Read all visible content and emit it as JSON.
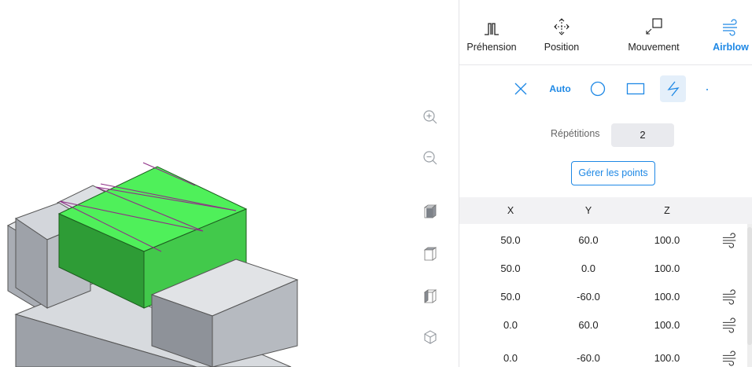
{
  "tabs": [
    {
      "label": "Préhension",
      "icon": "gripper-icon"
    },
    {
      "label": "Position",
      "icon": "move-arrows-icon"
    },
    {
      "label": "Mouvement",
      "icon": "movement-icon"
    },
    {
      "label": "Airblow",
      "icon": "airblow-icon",
      "active": true
    }
  ],
  "shapes": {
    "auto_label": "Auto",
    "selected": "zigzag",
    "accent": "#1e88e5"
  },
  "repetitions": {
    "label": "Répétitions",
    "value": "2"
  },
  "manage_points_label": "Gérer les points",
  "table": {
    "columns": [
      "X",
      "Y",
      "Z"
    ],
    "rows": [
      {
        "x": "50.0",
        "y": "60.0",
        "z": "100.0",
        "airblow": true
      },
      {
        "x": "50.0",
        "y": "0.0",
        "z": "100.0",
        "airblow": false
      },
      {
        "x": "50.0",
        "y": "-60.0",
        "z": "100.0",
        "airblow": true
      },
      {
        "x": "0.0",
        "y": "60.0",
        "z": "100.0",
        "airblow": true
      },
      {
        "x": "0.0",
        "y": "-60.0",
        "z": "100.0",
        "airblow": true
      }
    ]
  },
  "colors": {
    "accent": "#1e88e5",
    "part_green": "#44d94c",
    "part_grey": "#c9ccd2",
    "path_line": "#8e2e86"
  }
}
